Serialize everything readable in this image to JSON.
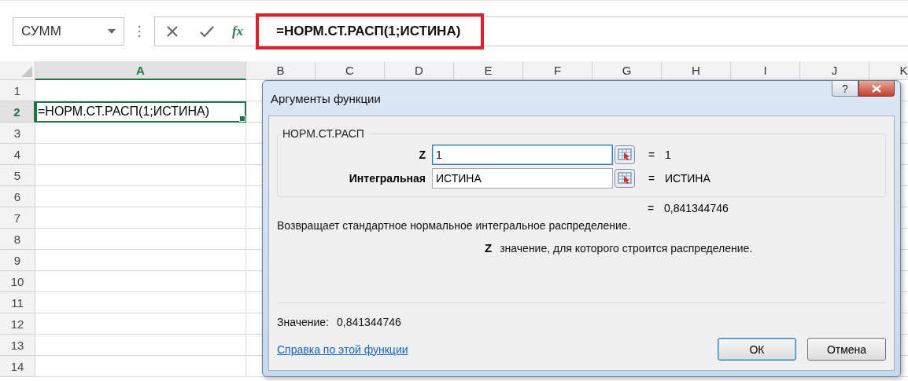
{
  "name_box": {
    "value": "СУММ"
  },
  "formula_bar": {
    "function_label": "fx",
    "formula": "=НОРМ.СТ.РАСП(1;ИСТИНА)",
    "highlighted": true
  },
  "columns": [
    {
      "label": "A",
      "selected": true
    },
    {
      "label": "B",
      "selected": false
    },
    {
      "label": "C",
      "selected": false
    },
    {
      "label": "D",
      "selected": false
    },
    {
      "label": "E",
      "selected": false
    },
    {
      "label": "F",
      "selected": false
    },
    {
      "label": "G",
      "selected": false
    },
    {
      "label": "H",
      "selected": false
    },
    {
      "label": "I",
      "selected": false
    },
    {
      "label": "J",
      "selected": false
    },
    {
      "label": "K",
      "selected": false
    }
  ],
  "rows": [
    {
      "label": "1",
      "selected": false,
      "cell_a": ""
    },
    {
      "label": "2",
      "selected": true,
      "cell_a": "=НОРМ.СТ.РАСП(1;ИСТИНА)"
    },
    {
      "label": "3",
      "selected": false,
      "cell_a": ""
    },
    {
      "label": "4",
      "selected": false,
      "cell_a": ""
    },
    {
      "label": "5",
      "selected": false,
      "cell_a": ""
    },
    {
      "label": "6",
      "selected": false,
      "cell_a": ""
    },
    {
      "label": "7",
      "selected": false,
      "cell_a": ""
    },
    {
      "label": "8",
      "selected": false,
      "cell_a": ""
    },
    {
      "label": "9",
      "selected": false,
      "cell_a": ""
    },
    {
      "label": "10",
      "selected": false,
      "cell_a": ""
    },
    {
      "label": "11",
      "selected": false,
      "cell_a": ""
    },
    {
      "label": "12",
      "selected": false,
      "cell_a": ""
    },
    {
      "label": "13",
      "selected": false,
      "cell_a": ""
    },
    {
      "label": "14",
      "selected": false,
      "cell_a": ""
    }
  ],
  "dialog": {
    "title": "Аргументы функции",
    "help_button": "?",
    "function_name": "НОРМ.СТ.РАСП",
    "arguments": [
      {
        "label": "Z",
        "value": "1",
        "sign": "=",
        "result": "1",
        "focused": true
      },
      {
        "label": "Интегральная",
        "value": "ИСТИНА",
        "sign": "=",
        "result": "ИСТИНА",
        "focused": false
      }
    ],
    "formula_result": {
      "sign": "=",
      "value": "0,841344746"
    },
    "description": "Возвращает стандартное нормальное интегральное распределение.",
    "argument_help": {
      "name": "Z",
      "text": "значение, для которого строится распределение."
    },
    "value_label": "Значение:",
    "value": "0,841344746",
    "help_link": "Справка по этой функции",
    "buttons": [
      {
        "label": "ОК",
        "default": true
      },
      {
        "label": "Отмена",
        "default": false
      }
    ]
  }
}
